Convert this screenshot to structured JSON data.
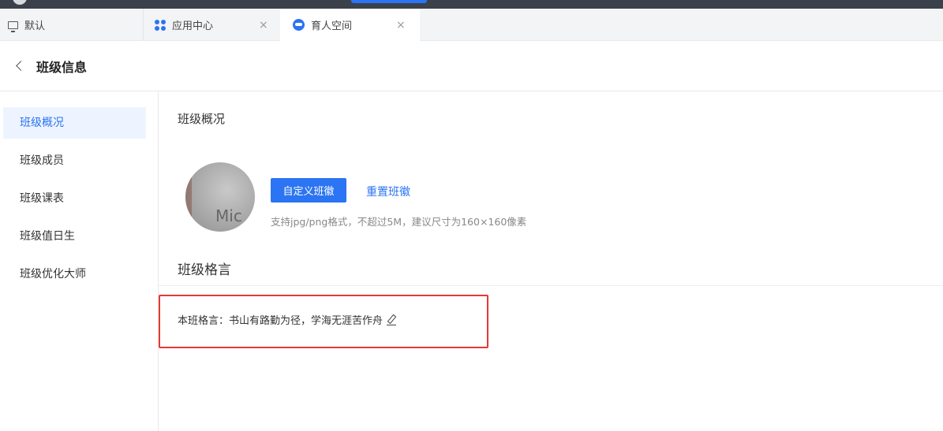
{
  "tabs": [
    {
      "label": "默认"
    },
    {
      "label": "应用中心",
      "close": "×"
    },
    {
      "label": "育人空间",
      "close": "×"
    }
  ],
  "header": {
    "title": "班级信息"
  },
  "sidebar": {
    "items": [
      {
        "label": "班级概况",
        "active": true
      },
      {
        "label": "班级成员"
      },
      {
        "label": "班级课表"
      },
      {
        "label": "班级值日生"
      },
      {
        "label": "班级优化大师"
      }
    ]
  },
  "main": {
    "section_title": "班级概况",
    "badge_image_text": "Mic",
    "custom_badge_button": "自定义班徽",
    "reset_badge_link": "重置班徽",
    "badge_hint": "支持jpg/png格式，不超过5M，建议尺寸为160×160像素",
    "motto_title": "班级格言",
    "motto_text": "本班格言：书山有路勤为径，学海无涯苦作舟"
  },
  "colors": {
    "accent": "#2b74f3",
    "highlight_border": "#e53935",
    "topbar": "#3a414b"
  }
}
